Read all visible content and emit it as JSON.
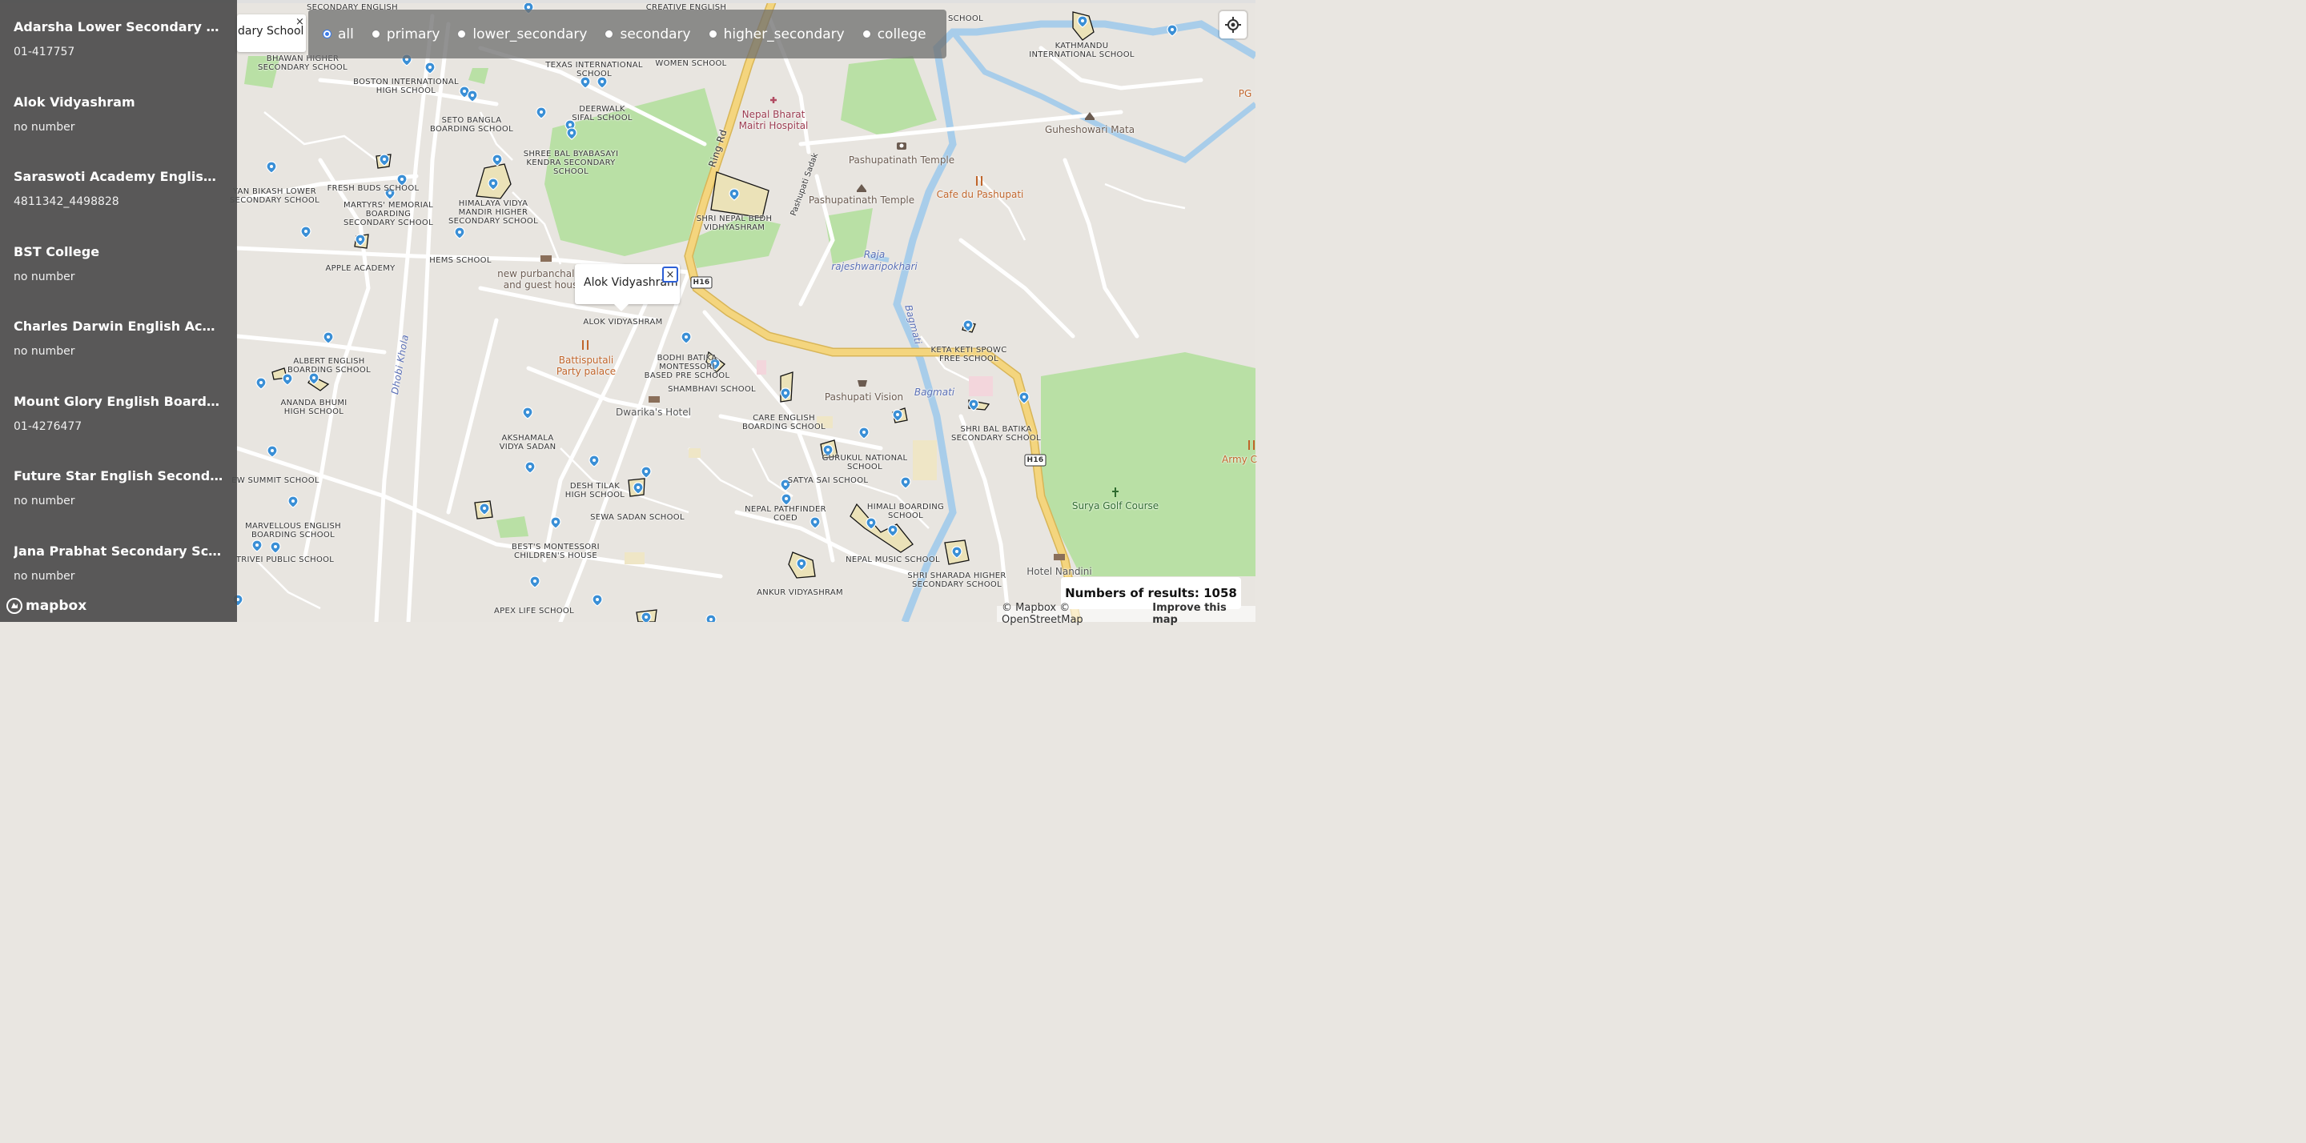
{
  "sidebar": {
    "items": [
      {
        "name": "Adarsha Lower Secondary School",
        "number": "01-417757"
      },
      {
        "name": "Alok Vidyashram",
        "number": "no number"
      },
      {
        "name": "Saraswoti Academy English School",
        "number": "4811342_4498828"
      },
      {
        "name": "BST College",
        "number": "no number"
      },
      {
        "name": "Charles Darwin English Academy",
        "number": "no number"
      },
      {
        "name": "Mount Glory English Boarding School",
        "number": "01-4276477"
      },
      {
        "name": "Future Star English Secondary School",
        "number": "no number"
      },
      {
        "name": "Jana Prabhat Secondary School",
        "number": "no number"
      }
    ]
  },
  "filter": {
    "options": [
      "all",
      "primary",
      "lower_secondary",
      "secondary",
      "higher_secondary",
      "college"
    ],
    "selected": "all"
  },
  "popups": {
    "left_text": "dary School",
    "center_text": "Alok Vidyashram",
    "close_glyph": "×"
  },
  "results": {
    "text": "Numbers of results: 1058"
  },
  "attribution": {
    "copyright": "© Mapbox © OpenStreetMap",
    "improve": "Improve this map"
  },
  "logo": {
    "text": "mapbox"
  },
  "map_labels": {
    "schools": [
      "SECONDARY ENGLISH",
      "CREATIVE ENGLISH",
      "SCHOOL",
      "KATHMANDU\nINTERNATIONAL SCHOOL",
      "BHAWAN HIGHER\nSECONDARY SCHOOL",
      "BOSTON INTERNATIONAL\nHIGH SCHOOL",
      "TEXAS INTERNATIONAL\nSCHOOL",
      "WOMEN SCHOOL",
      "DEERWALK\nSIFAL SCHOOL",
      "SETO BANGLA\nBOARDING SCHOOL",
      "SHREE BAL BYABASAYI\nKENDRA SECONDARY\nSCHOOL",
      "YAN BIKASH LOWER\nSECONDARY SCHOOL",
      "FRESH BUDS SCHOOL",
      "MARTYRS' MEMORIAL\nBOARDING\nSECONDARY SCHOOL",
      "HIMALAYA VIDYA\nMANDIR HIGHER\nSECONDARY SCHOOL",
      "SHRI NEPAL BEDH\nVIDHYASHRAM",
      "HEMS SCHOOL",
      "APPLE ACADEMY",
      "ALOK VIDYASHRAM",
      "BODHI BATIKA\nMONTESSORI\nBASED PRE SCHOOL",
      "SHAMBHAVI SCHOOL",
      "ALBERT ENGLISH\nBOARDING SCHOOL",
      "ANANDA BHUMI\nHIGH SCHOOL",
      "KETA KETI SPOWC\nFREE SCHOOL",
      "CARE ENGLISH\nBOARDING SCHOOL",
      "SHRI BAL BATIKA\nSECONDARY SCHOOL",
      "AKSHAMALA\nVIDYA SADAN",
      "GURUKUL NATIONAL\nSCHOOL",
      "DESH TILAK\nHIGH SCHOOL",
      "SATYA SAI SCHOOL",
      "EW SUMMIT SCHOOL",
      "NEPAL PATHFINDER\nCOED",
      "HIMALI BOARDING\nSCHOOL",
      "SEWA SADAN SCHOOL",
      "MARVELLOUS ENGLISH\nBOARDING SCHOOL",
      "BEST'S MONTESSORI\nCHILDREN'S HOUSE",
      "TRIVEI PUBLIC SCHOOL",
      "NEPAL MUSIC SCHOOL",
      "SHRI SHARADA HIGHER\nSECONDARY SCHOOL",
      "ANKUR VIDYASHRAM",
      "APEX LIFE SCHOOL"
    ],
    "places": {
      "hospital": "Nepal Bharat\nMaitri Hospital",
      "temple1": "Pashupatinath Temple",
      "temple2": "Pashupatinath Temple",
      "cafe": "Cafe du Pashupati",
      "mata": "Guheshowari Mata",
      "guesthouse": "new purbanchal h\nand guest hous",
      "palace": "Battisputali\nParty palace",
      "hotel": "Dwarika's Hotel",
      "vision": "Pashupati Vision",
      "golf": "Surya Golf Course",
      "nandini": "Hotel Nandini",
      "army": "Army C",
      "pg": "PG",
      "pond": "Raja\nrajeshwaripokhari",
      "river1": "Bagmati",
      "river2": "Bagmati",
      "khola": "Dhobi Khola",
      "ringrd": "Ring Rd",
      "sadak": "Pashupati Sadak",
      "h16a": "H16",
      "h16b": "H16"
    }
  }
}
